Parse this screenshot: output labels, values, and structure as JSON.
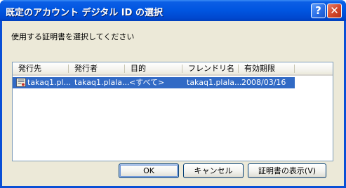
{
  "window": {
    "title": "既定のアカウント デジタル ID の選択",
    "help_label": "?",
    "close_label": "✕"
  },
  "instruction": "使用する証明書を選択してください",
  "columns": [
    "発行先",
    "発行者",
    "目的",
    "フレンドリ名",
    "有効期限"
  ],
  "rows": [
    {
      "issued_to": "takaq1.pl...",
      "issued_by": "takaq1.plala...",
      "purpose": "<すべて>",
      "friendly_name": "takaq1.plala...",
      "expiration": "2008/03/16",
      "icon": "certificate-icon",
      "selected": true
    }
  ],
  "buttons": {
    "ok": "OK",
    "cancel": "キャンセル",
    "view_cert": "証明書の表示(V)"
  },
  "colors": {
    "titlebar": "#0055e0",
    "selection": "#316ac5",
    "dialog_face": "#ece9d8"
  }
}
